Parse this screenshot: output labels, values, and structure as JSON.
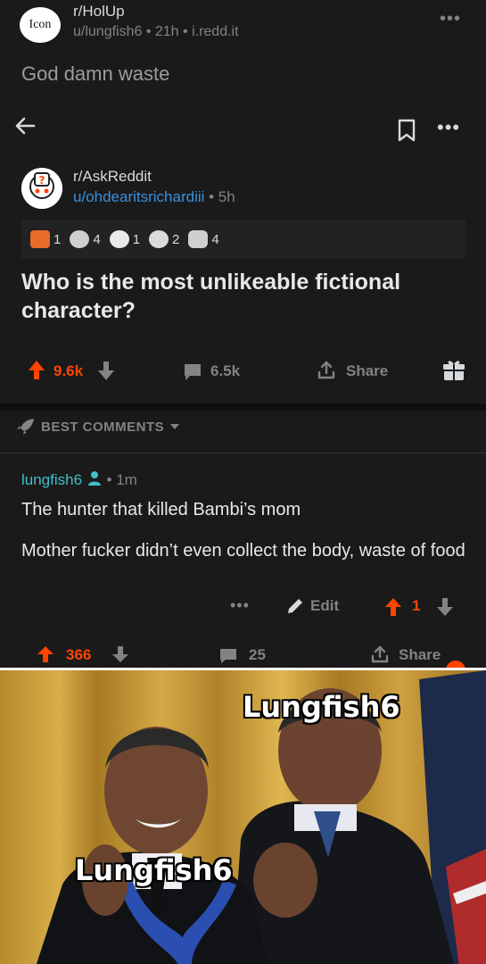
{
  "post": {
    "avatar_alt": "Icon",
    "subreddit": "r/HolUp",
    "meta": "u/lungfish6 • 21h • i.redd.it",
    "more": "•••",
    "title": "God damn waste"
  },
  "embedded": {
    "subreddit": "r/AskReddit",
    "user": "u/ohdearitsrichardiii",
    "time": " • 5h",
    "awards": [
      {
        "count": "1",
        "icon": "award-hugz-icon",
        "color": "#e86b2a"
      },
      {
        "count": "4",
        "icon": "award-wholesome-icon",
        "color": "#cfcfcf"
      },
      {
        "count": "1",
        "icon": "award-silver-icon",
        "color": "#e9e9e9"
      },
      {
        "count": "2",
        "icon": "award-coin-icon",
        "color": "#dadada"
      },
      {
        "count": "4",
        "icon": "award-bear-icon",
        "color": "#cfcfcf"
      }
    ],
    "question": "Who is the most unlikeable fictional character?",
    "upvotes": "9.6k",
    "comments": "6.5k",
    "share": "Share",
    "sort_label": "BEST COMMENTS"
  },
  "comment": {
    "user": "lungfish6",
    "time": " • 1m",
    "line1": "The hunter that killed Bambi’s mom",
    "line2": "Mother fucker didn’t even collect the body, waste of food",
    "more": "•••",
    "edit": "Edit",
    "score": "1"
  },
  "bottom_bar": {
    "upvotes": "366",
    "comments": "25",
    "share": "Share"
  },
  "meme": {
    "caption_top": "Lungfish6",
    "caption_bottom": "Lungfish6"
  },
  "colors": {
    "background": "#1a1a1b",
    "upvote": "#ff4500",
    "link": "#3a8fd9",
    "comment_user": "#3ec0c9"
  }
}
